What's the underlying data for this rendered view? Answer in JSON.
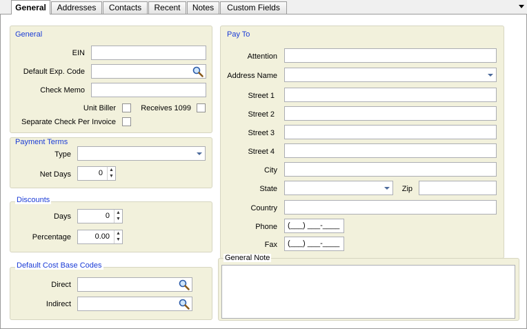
{
  "tabs": [
    "General",
    "Addresses",
    "Contacts",
    "Recent",
    "Notes",
    "Custom Fields"
  ],
  "general": {
    "title": "General",
    "ein_label": "EIN",
    "ein_value": "",
    "exp_code_label": "Default Exp. Code",
    "exp_code_value": "",
    "check_memo_label": "Check Memo",
    "check_memo_value": "",
    "unit_biller_label": "Unit Biller",
    "unit_biller_checked": false,
    "receives_1099_label": "Receives 1099",
    "receives_1099_checked": false,
    "separate_check_label": "Separate Check Per Invoice",
    "separate_check_checked": false
  },
  "payment_terms": {
    "title": "Payment Terms",
    "type_label": "Type",
    "type_value": "",
    "net_days_label": "Net Days",
    "net_days_value": "0"
  },
  "discounts": {
    "title": "Discounts",
    "days_label": "Days",
    "days_value": "0",
    "percentage_label": "Percentage",
    "percentage_value": "0.00"
  },
  "cost_base": {
    "title": "Default Cost Base Codes",
    "direct_label": "Direct",
    "direct_value": "",
    "indirect_label": "Indirect",
    "indirect_value": ""
  },
  "pay_to": {
    "title": "Pay To",
    "attention_label": "Attention",
    "address_name_label": "Address Name",
    "street1_label": "Street 1",
    "street2_label": "Street 2",
    "street3_label": "Street 3",
    "street4_label": "Street 4",
    "city_label": "City",
    "state_label": "State",
    "zip_label": "Zip",
    "country_label": "Country",
    "phone_label": "Phone",
    "phone_mask": "(___) ___-____",
    "fax_label": "Fax",
    "fax_mask": "(___) ___-____"
  },
  "general_note": {
    "title": "General Note",
    "value": ""
  },
  "colors": {
    "group_bg": "#f2f1dc",
    "group_title": "#1a3bd6"
  }
}
